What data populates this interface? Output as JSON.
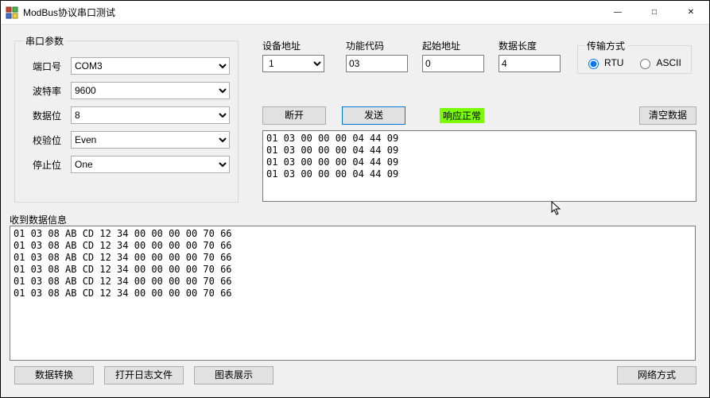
{
  "window": {
    "title": "ModBus协议串口测试"
  },
  "serial": {
    "legend": "串口参数",
    "port_label": "端口号",
    "port_value": "COM3",
    "baud_label": "波特率",
    "baud_value": "9600",
    "databits_label": "数据位",
    "databits_value": "8",
    "parity_label": "校验位",
    "parity_value": "Even",
    "stopbits_label": "停止位",
    "stopbits_value": "One"
  },
  "params": {
    "addr_label": "设备地址",
    "addr_value": "1",
    "func_label": "功能代码",
    "func_value": "03",
    "start_label": "起始地址",
    "start_value": "0",
    "len_label": "数据长度",
    "len_value": "4"
  },
  "transmit": {
    "legend": "传输方式",
    "rtu_label": "RTU",
    "ascii_label": "ASCII",
    "selected": "RTU"
  },
  "buttons": {
    "disconnect": "断开",
    "send": "发送",
    "clear": "清空数据",
    "convert": "数据转换",
    "openlog": "打开日志文件",
    "chart": "图表展示",
    "netmode": "网络方式"
  },
  "status": {
    "text": "响应正常",
    "color": "#7CFC00"
  },
  "send_log": "01 03 00 00 00 04 44 09\n01 03 00 00 00 04 44 09\n01 03 00 00 00 04 44 09\n01 03 00 00 00 04 44 09",
  "recv": {
    "label": "收到数据信息",
    "log": "01 03 08 AB CD 12 34 00 00 00 00 70 66\n01 03 08 AB CD 12 34 00 00 00 00 70 66\n01 03 08 AB CD 12 34 00 00 00 00 70 66\n01 03 08 AB CD 12 34 00 00 00 00 70 66\n01 03 08 AB CD 12 34 00 00 00 00 70 66\n01 03 08 AB CD 12 34 00 00 00 00 70 66"
  }
}
